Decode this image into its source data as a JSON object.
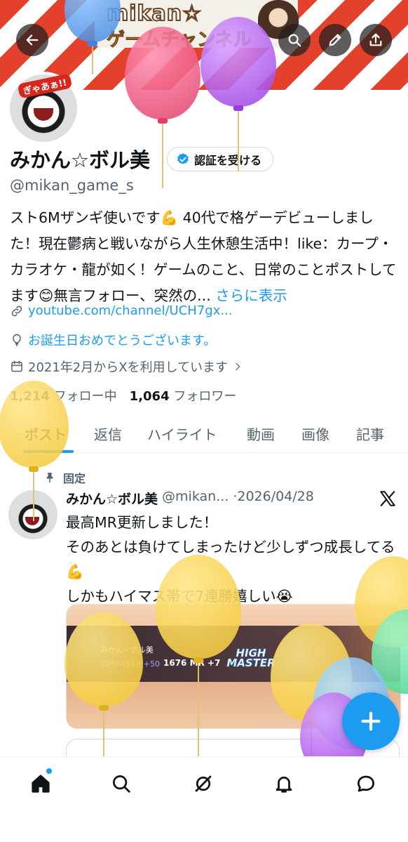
{
  "banner": {
    "logo_text": "mikan☆",
    "logo_sub": "ゲームチャンネル"
  },
  "top_buttons": {
    "back": "back-arrow-icon",
    "search": "search-icon",
    "edit": "pencil-icon",
    "share": "share-icon"
  },
  "profile": {
    "avatar_badge": "ぎゃあぁ!!",
    "name": "みかん☆ボル美",
    "verify_label": "認証を受ける",
    "handle": "@mikan_game_s",
    "bio_text": "スト6Mザンギ使いです💪 40代で格ゲーデビューしました！現在鬱病と戦いながら人生休憩生活中！like：カープ・カラオケ・龍が如く！ゲームのこと、日常のことポストしてます😊無言フォロー、突然の...",
    "bio_more": "さらに表示",
    "link": "youtube.com/channel/UCH7gx...",
    "birthday": "お誕生日おめでとうございます。",
    "joined": "2021年2月からXを利用しています",
    "following_count": "1,214",
    "following_label": "フォロー中",
    "followers_count": "1,064",
    "followers_label": "フォロワー"
  },
  "tabs": [
    {
      "label": "ポスト",
      "active": true
    },
    {
      "label": "返信",
      "active": false
    },
    {
      "label": "ハイライト",
      "active": false
    },
    {
      "label": "動画",
      "active": false
    },
    {
      "label": "画像",
      "active": false
    },
    {
      "label": "記事",
      "active": false
    }
  ],
  "pinned_post": {
    "pinned_label": "固定",
    "author_name": "みかん☆ボル美",
    "author_handle": "@mikan...",
    "date": "·2026/04/28",
    "text": "最高MR更新しました！\nそのあとは負けてしまったけど少しずつ成長してる💪\nしかもハイマス帯で7連勝嬉しい😭",
    "media": {
      "player_name": "みかん☆ボル美",
      "lp": "329443 LP +50",
      "mr": "1676 MR +7",
      "rank": "HIGH MASTER"
    }
  },
  "bottom_nav": [
    "home-icon",
    "search-icon",
    "grok-icon",
    "notifications-icon",
    "messages-icon"
  ],
  "colors": {
    "accent": "#1d9bf0",
    "banner_red": "#e4412c",
    "text": "#0f1419",
    "muted": "#536471"
  }
}
